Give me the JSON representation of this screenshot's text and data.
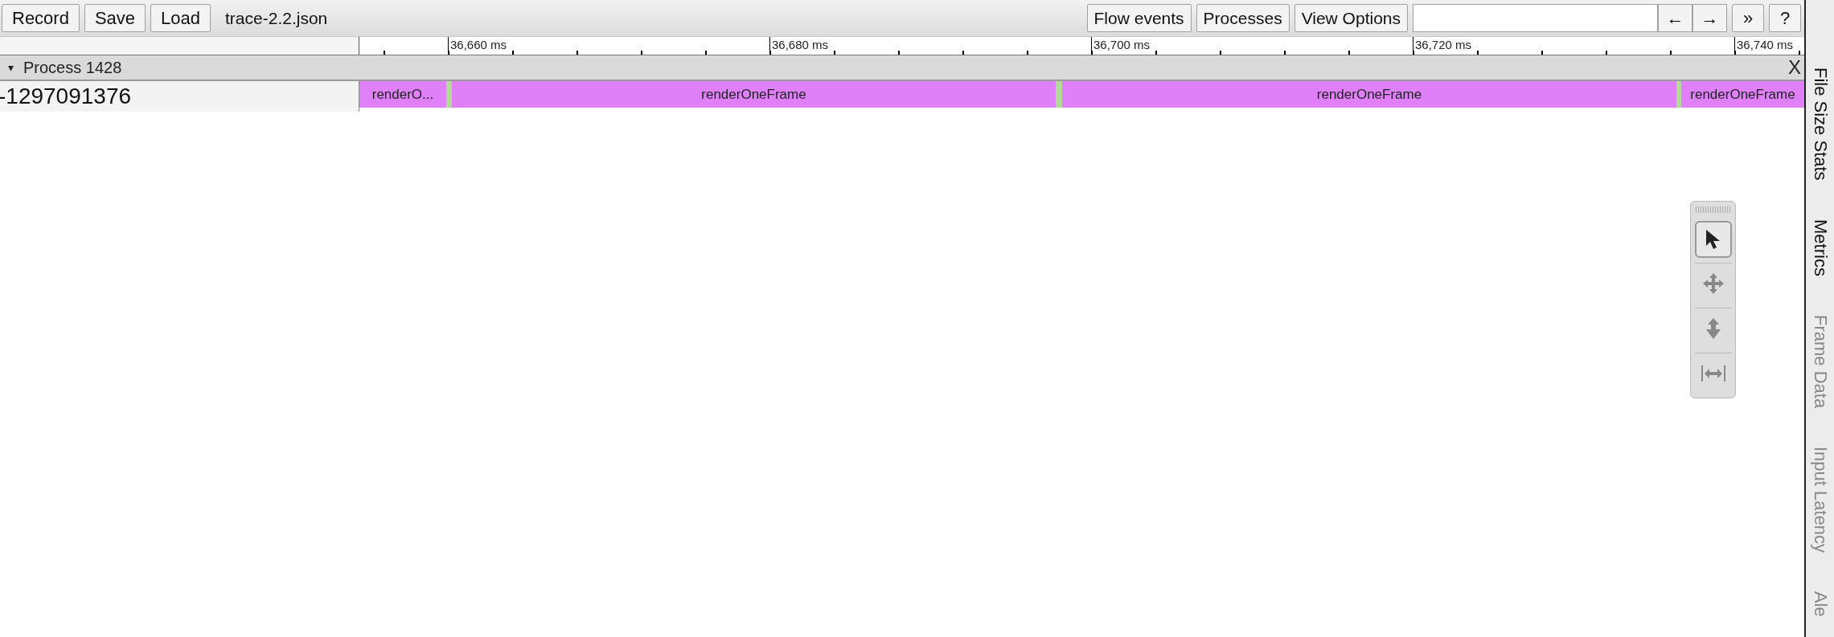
{
  "toolbar": {
    "left_buttons": [
      "Record",
      "Save",
      "Load"
    ],
    "file_name": "trace-2.2.json",
    "right_buttons": [
      "Flow events",
      "Processes",
      "View Options"
    ],
    "nav_buttons": [
      "←",
      "→"
    ],
    "more_button": "»",
    "help_button": "?"
  },
  "ruler": {
    "ticks": [
      {
        "label": "36,660 ms"
      },
      {
        "label": "36,680 ms"
      },
      {
        "label": "36,700 ms"
      },
      {
        "label": "36,720 ms"
      },
      {
        "label": "36,740 ms"
      }
    ]
  },
  "process": {
    "title": "Process 1428",
    "expanded": true,
    "expander": "▾",
    "close": "X",
    "threads": [
      {
        "name": "-1297091376",
        "slices": [
          {
            "label": "renderO...",
            "color": "#e080f8"
          },
          {
            "color": "#b2d89a"
          },
          {
            "label": "renderOneFrame",
            "color": "#e080f8"
          },
          {
            "color": "#b2d89a"
          },
          {
            "label": "renderOneFrame",
            "color": "#e080f8"
          },
          {
            "color": "#b2d89a"
          },
          {
            "label": "renderOneFrame",
            "color": "#e080f8"
          }
        ]
      }
    ]
  },
  "side_tabs": [
    {
      "label": "File Size Stats",
      "disabled": false
    },
    {
      "label": "Metrics",
      "disabled": false
    },
    {
      "label": "Frame Data",
      "disabled": true
    },
    {
      "label": "Input Latency",
      "disabled": true
    },
    {
      "label": "Ale",
      "disabled": true
    }
  ],
  "tool_palette": {
    "tools": [
      {
        "kind": "select",
        "selected": true
      },
      {
        "kind": "pan",
        "selected": false
      },
      {
        "kind": "zoom",
        "selected": false
      },
      {
        "kind": "timing",
        "selected": false
      }
    ]
  }
}
